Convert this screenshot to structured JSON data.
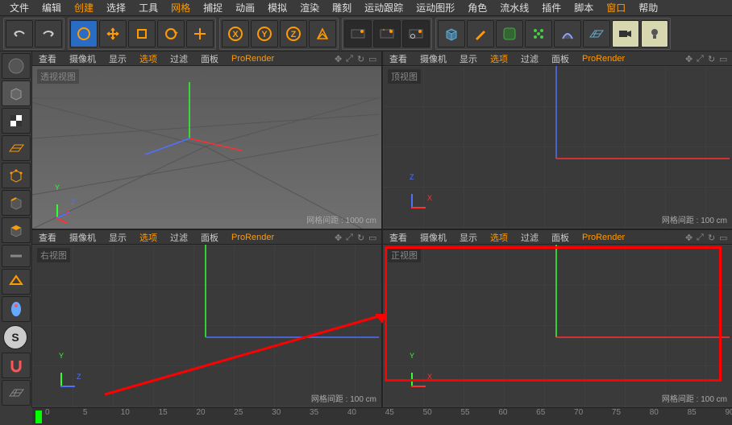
{
  "menubar": {
    "items": [
      "文件",
      "编辑",
      "创建",
      "选择",
      "工具",
      "网格",
      "捕捉",
      "动画",
      "模拟",
      "渲染",
      "雕刻",
      "运动跟踪",
      "运动图形",
      "角色",
      "流水线",
      "插件",
      "脚本",
      "窗口",
      "帮助"
    ],
    "highlight_indices": [
      2,
      5,
      17
    ]
  },
  "viewports": {
    "menu_items": [
      "查看",
      "摄像机",
      "显示",
      "选项",
      "过滤",
      "面板",
      "ProRender"
    ],
    "tl": {
      "label": "透视视图",
      "spacing": "网格间距 : 1000 cm"
    },
    "tr": {
      "label": "顶视图",
      "spacing": "网格间距 : 100 cm"
    },
    "bl": {
      "label": "右视图",
      "spacing": "网格间距 : 100 cm"
    },
    "br": {
      "label": "正视图",
      "spacing": "网格间距 : 100 cm"
    }
  },
  "timeline": {
    "ticks": [
      "0",
      "5",
      "10",
      "15",
      "20",
      "25",
      "30",
      "35",
      "40",
      "45",
      "50",
      "55",
      "60",
      "65",
      "70",
      "75",
      "80",
      "85",
      "90"
    ]
  },
  "axes": {
    "x": "X",
    "y": "Y",
    "z": "Z"
  },
  "colors": {
    "accent": "#ff9a00",
    "axis_x": "#ff3030",
    "axis_y": "#30ff30",
    "axis_z": "#5070ff"
  }
}
